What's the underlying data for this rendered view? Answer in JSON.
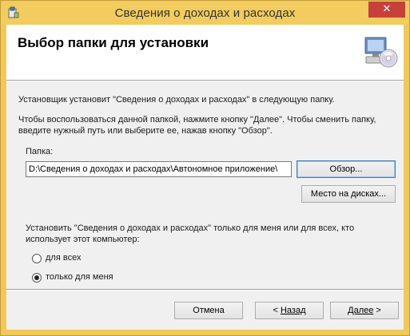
{
  "window": {
    "title": "Сведения о доходах и расходах",
    "close_glyph": "✕",
    "accent": "#f2cc5e",
    "close_color": "#c7413a"
  },
  "banner": {
    "title": "Выбор папки для установки",
    "icon": "computer-cd-icon"
  },
  "text": {
    "line1": "Установщик установит \"Сведения о доходах и расходах\" в следующую папку.",
    "line2": "Чтобы воспользоваться данной папкой, нажмите кнопку \"Далее\". Чтобы сменить папку, введите нужный путь или выберите ее, нажав кнопку \"Обзор\"."
  },
  "folder": {
    "label": "Папка:",
    "path": "D:\\Сведения о доходах и расходах\\Автономное приложение\\"
  },
  "buttons": {
    "browse": "Обзор...",
    "disk_cost": "Место на дисках...",
    "cancel": "Отмена",
    "back_arrow": "<",
    "back": "Назад",
    "next": "Далее",
    "next_arrow": ">"
  },
  "install_for": {
    "question": "Установить \"Сведения о доходах и расходах\" только для меня или для всех, кто использует этот компьютер:",
    "options": [
      {
        "label": "для всех",
        "selected": false
      },
      {
        "label": "только для меня",
        "selected": true
      }
    ]
  }
}
